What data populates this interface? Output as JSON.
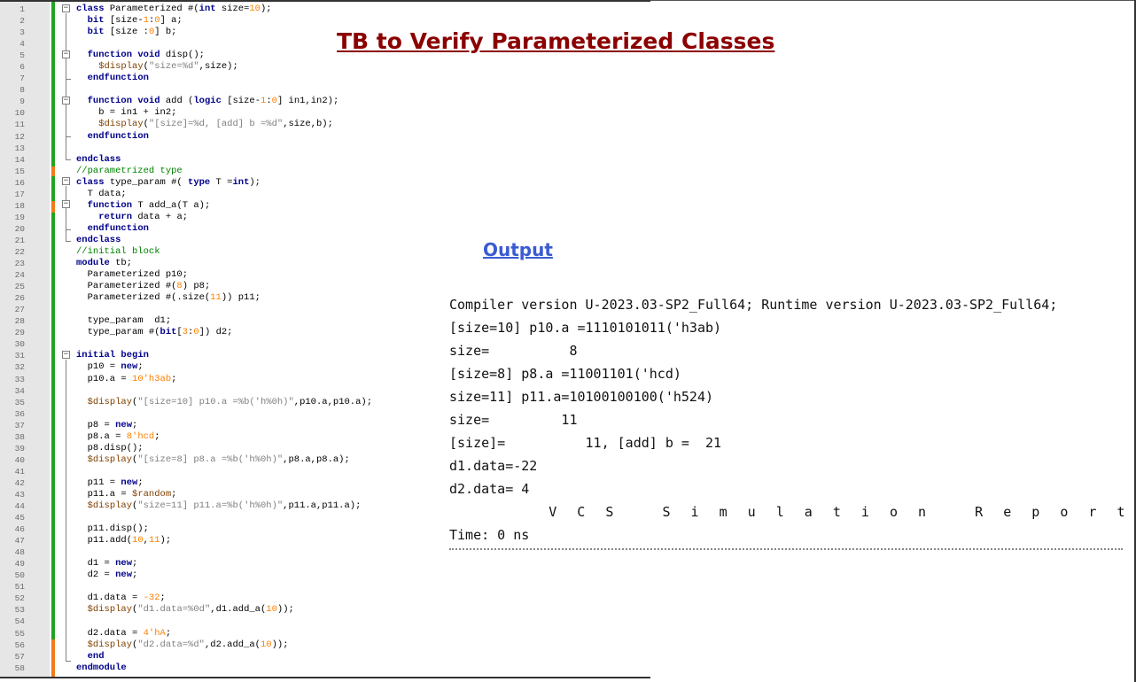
{
  "slide": {
    "title": "TB to Verify Parameterized Classes",
    "output_heading": "Output"
  },
  "editor": {
    "lines": [
      {
        "n": "1",
        "t": [
          [
            "kw",
            "class"
          ],
          [
            "",
            " Parameterized #("
          ],
          [
            "kw",
            "int"
          ],
          [
            "",
            " size="
          ],
          [
            "num",
            "10"
          ],
          [
            "",
            ");"
          ]
        ]
      },
      {
        "n": "2",
        "t": [
          [
            "",
            "  "
          ],
          [
            "kw",
            "bit"
          ],
          [
            "",
            " [size-"
          ],
          [
            "num",
            "1"
          ],
          [
            "",
            ":"
          ],
          [
            "num",
            "0"
          ],
          [
            "",
            "] a;"
          ]
        ]
      },
      {
        "n": "3",
        "t": [
          [
            "",
            "  "
          ],
          [
            "kw",
            "bit"
          ],
          [
            "",
            " [size :"
          ],
          [
            "num",
            "0"
          ],
          [
            "",
            "] b;"
          ]
        ]
      },
      {
        "n": "4",
        "t": [
          [
            "",
            ""
          ]
        ]
      },
      {
        "n": "5",
        "t": [
          [
            "",
            "  "
          ],
          [
            "kw",
            "function"
          ],
          [
            "",
            " "
          ],
          [
            "kw",
            "void"
          ],
          [
            "",
            " disp();"
          ]
        ]
      },
      {
        "n": "6",
        "t": [
          [
            "",
            "    "
          ],
          [
            "sys",
            "$display"
          ],
          [
            "",
            "("
          ],
          [
            "str",
            "\"size=%d\""
          ],
          [
            "",
            ",size);"
          ]
        ]
      },
      {
        "n": "7",
        "t": [
          [
            "",
            "  "
          ],
          [
            "kw",
            "endfunction"
          ]
        ]
      },
      {
        "n": "8",
        "t": [
          [
            "",
            ""
          ]
        ]
      },
      {
        "n": "9",
        "t": [
          [
            "",
            "  "
          ],
          [
            "kw",
            "function"
          ],
          [
            "",
            " "
          ],
          [
            "kw",
            "void"
          ],
          [
            "",
            " add ("
          ],
          [
            "kw",
            "logic"
          ],
          [
            "",
            " [size-"
          ],
          [
            "num",
            "1"
          ],
          [
            "",
            ":"
          ],
          [
            "num",
            "0"
          ],
          [
            "",
            "] in1,in2);"
          ]
        ]
      },
      {
        "n": "10",
        "t": [
          [
            "",
            "    b = in1 + in2;"
          ]
        ]
      },
      {
        "n": "11",
        "t": [
          [
            "",
            "    "
          ],
          [
            "sys",
            "$display"
          ],
          [
            "",
            "("
          ],
          [
            "str",
            "\"[size]=%d, [add] b =%d\""
          ],
          [
            "",
            ",size,b);"
          ]
        ]
      },
      {
        "n": "12",
        "t": [
          [
            "",
            "  "
          ],
          [
            "kw",
            "endfunction"
          ]
        ]
      },
      {
        "n": "13",
        "t": [
          [
            "",
            ""
          ]
        ]
      },
      {
        "n": "14",
        "t": [
          [
            "kw",
            "endclass"
          ]
        ]
      },
      {
        "n": "15",
        "t": [
          [
            "cmt",
            "//parametrized type"
          ]
        ]
      },
      {
        "n": "16",
        "t": [
          [
            "kw",
            "class"
          ],
          [
            "",
            " type_param #( "
          ],
          [
            "kw",
            "type"
          ],
          [
            "",
            " T ="
          ],
          [
            "kw",
            "int"
          ],
          [
            "",
            ");"
          ]
        ]
      },
      {
        "n": "17",
        "t": [
          [
            "",
            "  T data;"
          ]
        ]
      },
      {
        "n": "18",
        "t": [
          [
            "",
            "  "
          ],
          [
            "kw",
            "function"
          ],
          [
            "",
            " T add_a(T a);"
          ]
        ]
      },
      {
        "n": "19",
        "t": [
          [
            "",
            "    "
          ],
          [
            "kw",
            "return"
          ],
          [
            "",
            " data + a;"
          ]
        ]
      },
      {
        "n": "20",
        "t": [
          [
            "",
            "  "
          ],
          [
            "kw",
            "endfunction"
          ]
        ]
      },
      {
        "n": "21",
        "t": [
          [
            "kw",
            "endclass"
          ]
        ]
      },
      {
        "n": "22",
        "t": [
          [
            "cmt",
            "//initial block"
          ]
        ]
      },
      {
        "n": "23",
        "t": [
          [
            "kw",
            "module"
          ],
          [
            "",
            " tb;"
          ]
        ]
      },
      {
        "n": "24",
        "t": [
          [
            "",
            "  Parameterized p10;"
          ]
        ]
      },
      {
        "n": "25",
        "t": [
          [
            "",
            "  Parameterized #("
          ],
          [
            "num",
            "8"
          ],
          [
            "",
            ") p8;"
          ]
        ]
      },
      {
        "n": "26",
        "t": [
          [
            "",
            "  Parameterized #(.size("
          ],
          [
            "num",
            "11"
          ],
          [
            "",
            ")) p11;"
          ]
        ]
      },
      {
        "n": "27",
        "t": [
          [
            "",
            ""
          ]
        ]
      },
      {
        "n": "28",
        "t": [
          [
            "",
            "  type_param  d1;"
          ]
        ]
      },
      {
        "n": "29",
        "t": [
          [
            "",
            "  type_param #("
          ],
          [
            "kw",
            "bit"
          ],
          [
            "",
            "["
          ],
          [
            "num",
            "3"
          ],
          [
            "",
            ":"
          ],
          [
            "num",
            "0"
          ],
          [
            "",
            "]) d2;"
          ]
        ]
      },
      {
        "n": "30",
        "t": [
          [
            "",
            ""
          ]
        ]
      },
      {
        "n": "31",
        "t": [
          [
            "kw",
            "initial"
          ],
          [
            "",
            " "
          ],
          [
            "kw",
            "begin"
          ]
        ]
      },
      {
        "n": "32",
        "t": [
          [
            "",
            "  p10 = "
          ],
          [
            "kw",
            "new"
          ],
          [
            "",
            ";"
          ]
        ]
      },
      {
        "n": "33",
        "t": [
          [
            "",
            "  p10.a = "
          ],
          [
            "num",
            "10'h3ab"
          ],
          [
            "",
            ";"
          ]
        ]
      },
      {
        "n": "34",
        "t": [
          [
            "",
            ""
          ]
        ]
      },
      {
        "n": "35",
        "t": [
          [
            "",
            "  "
          ],
          [
            "sys",
            "$display"
          ],
          [
            "",
            "("
          ],
          [
            "str",
            "\"[size=10] p10.a =%b('h%0h)\""
          ],
          [
            "",
            ",p10.a,p10.a);"
          ]
        ]
      },
      {
        "n": "36",
        "t": [
          [
            "",
            ""
          ]
        ]
      },
      {
        "n": "37",
        "t": [
          [
            "",
            "  p8 = "
          ],
          [
            "kw",
            "new"
          ],
          [
            "",
            ";"
          ]
        ]
      },
      {
        "n": "38",
        "t": [
          [
            "",
            "  p8.a = "
          ],
          [
            "num",
            "8'hcd"
          ],
          [
            "",
            ";"
          ]
        ]
      },
      {
        "n": "39",
        "t": [
          [
            "",
            "  p8.disp();"
          ]
        ]
      },
      {
        "n": "40",
        "t": [
          [
            "",
            "  "
          ],
          [
            "sys",
            "$display"
          ],
          [
            "",
            "("
          ],
          [
            "str",
            "\"[size=8] p8.a =%b('h%0h)\""
          ],
          [
            "",
            ",p8.a,p8.a);"
          ]
        ]
      },
      {
        "n": "41",
        "t": [
          [
            "",
            ""
          ]
        ]
      },
      {
        "n": "42",
        "t": [
          [
            "",
            "  p11 = "
          ],
          [
            "kw",
            "new"
          ],
          [
            "",
            ";"
          ]
        ]
      },
      {
        "n": "43",
        "t": [
          [
            "",
            "  p11.a = "
          ],
          [
            "sys",
            "$random"
          ],
          [
            "",
            ";"
          ]
        ]
      },
      {
        "n": "44",
        "t": [
          [
            "",
            "  "
          ],
          [
            "sys",
            "$display"
          ],
          [
            "",
            "("
          ],
          [
            "str",
            "\"size=11] p11.a=%b('h%0h)\""
          ],
          [
            "",
            ",p11.a,p11.a);"
          ]
        ]
      },
      {
        "n": "45",
        "t": [
          [
            "",
            ""
          ]
        ]
      },
      {
        "n": "46",
        "t": [
          [
            "",
            "  p11.disp();"
          ]
        ]
      },
      {
        "n": "47",
        "t": [
          [
            "",
            "  p11.add("
          ],
          [
            "num",
            "10"
          ],
          [
            "",
            ","
          ],
          [
            "num",
            "11"
          ],
          [
            "",
            ");"
          ]
        ]
      },
      {
        "n": "48",
        "t": [
          [
            "",
            ""
          ]
        ]
      },
      {
        "n": "49",
        "t": [
          [
            "",
            "  d1 = "
          ],
          [
            "kw",
            "new"
          ],
          [
            "",
            ";"
          ]
        ]
      },
      {
        "n": "50",
        "t": [
          [
            "",
            "  d2 = "
          ],
          [
            "kw",
            "new"
          ],
          [
            "",
            ";"
          ]
        ]
      },
      {
        "n": "51",
        "t": [
          [
            "",
            ""
          ]
        ]
      },
      {
        "n": "52",
        "t": [
          [
            "",
            "  d1.data = "
          ],
          [
            "num",
            "-32"
          ],
          [
            "",
            ";"
          ]
        ]
      },
      {
        "n": "53",
        "t": [
          [
            "",
            "  "
          ],
          [
            "sys",
            "$display"
          ],
          [
            "",
            "("
          ],
          [
            "str",
            "\"d1.data=%0d\""
          ],
          [
            "",
            ",d1.add_a("
          ],
          [
            "num",
            "10"
          ],
          [
            "",
            "));"
          ]
        ]
      },
      {
        "n": "54",
        "t": [
          [
            "",
            ""
          ]
        ]
      },
      {
        "n": "55",
        "t": [
          [
            "",
            "  d2.data = "
          ],
          [
            "num",
            "4'hA"
          ],
          [
            "",
            ";"
          ]
        ]
      },
      {
        "n": "56",
        "t": [
          [
            "",
            "  "
          ],
          [
            "sys",
            "$display"
          ],
          [
            "",
            "("
          ],
          [
            "str",
            "\"d2.data=%d\""
          ],
          [
            "",
            ",d2.add_a("
          ],
          [
            "num",
            "10"
          ],
          [
            "",
            "));"
          ]
        ]
      },
      {
        "n": "57",
        "t": [
          [
            "",
            "  "
          ],
          [
            "kw",
            "end"
          ]
        ]
      },
      {
        "n": "58",
        "t": [
          [
            "kw",
            "endmodule"
          ]
        ]
      }
    ]
  },
  "output": {
    "lines": [
      "Compiler version U-2023.03-SP2_Full64; Runtime version U-2023.03-SP2_Full64;",
      "[size=10] p10.a =1110101011('h3ab)",
      "size=          8",
      "[size=8] p8.a =11001101('hcd)",
      "size=11] p11.a=10100100100('h524)",
      "size=         11",
      "[size]=          11, [add] b =  21",
      "d1.data=-22",
      "d2.data= 4",
      "       V C S   S i m u l a t i o n   R e p o r t",
      "Time: 0 ns"
    ]
  }
}
